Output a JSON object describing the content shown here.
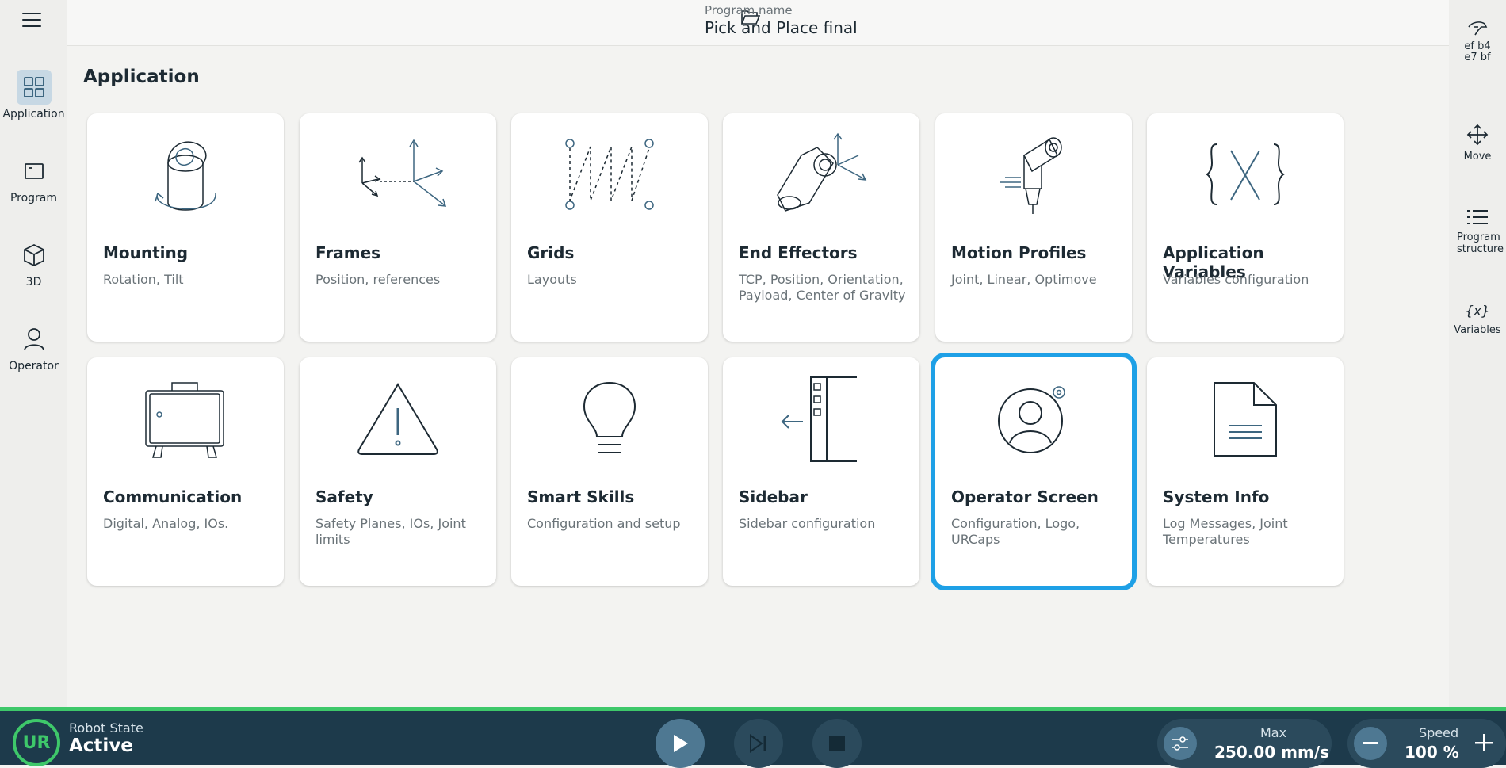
{
  "header": {
    "program_label": "Program name",
    "program_name": "Pick and Place final"
  },
  "left_nav": [
    {
      "label": "Application",
      "icon": "grid-icon",
      "active": true
    },
    {
      "label": "Program",
      "icon": "program-icon"
    },
    {
      "label": "3D",
      "icon": "cube-icon"
    },
    {
      "label": "Operator",
      "icon": "operator-icon"
    }
  ],
  "right_nav": {
    "hand_code": "ef b4\ne7 bf",
    "move": "Move",
    "program_structure": "Program structure",
    "variables": "Variables"
  },
  "main": {
    "title": "Application",
    "cards": [
      {
        "title": "Mounting",
        "subtitle": "Rotation, Tilt",
        "icon": "mounting-icon"
      },
      {
        "title": "Frames",
        "subtitle": "Position, references",
        "icon": "frames-icon"
      },
      {
        "title": "Grids",
        "subtitle": "Layouts",
        "icon": "grids-icon"
      },
      {
        "title": "End Effectors",
        "subtitle": "TCP, Position, Orientation, Payload, Center of Gravity",
        "icon": "end-effector-icon"
      },
      {
        "title": "Motion Profiles",
        "subtitle": "Joint, Linear, Optimove",
        "icon": "motion-profile-icon"
      },
      {
        "title": "Application Variables",
        "subtitle": "Variables configuration",
        "icon": "variables-icon"
      },
      {
        "title": "Communication",
        "subtitle": "Digital, Analog, IOs.",
        "icon": "communication-icon"
      },
      {
        "title": "Safety",
        "subtitle": "Safety Planes, IOs, Joint limits",
        "icon": "safety-icon"
      },
      {
        "title": "Smart Skills",
        "subtitle": "Configuration and setup",
        "icon": "lightbulb-icon"
      },
      {
        "title": "Sidebar",
        "subtitle": "Sidebar configuration",
        "icon": "sidebar-icon"
      },
      {
        "title": "Operator Screen",
        "subtitle": "Configuration, Logo, URCaps",
        "icon": "operator-screen-icon",
        "selected": true
      },
      {
        "title": "System Info",
        "subtitle": "Log Messages, Joint Temperatures",
        "icon": "document-icon"
      }
    ]
  },
  "footer": {
    "robot_state_label": "Robot State",
    "robot_state_value": "Active",
    "max_label": "Max",
    "max_value": "250.00 mm/s",
    "speed_label": "Speed",
    "speed_value": "100 %",
    "logo_text": "UR"
  },
  "colors": {
    "accent": "#1ea0e6",
    "footer_bg": "#1d3a4b",
    "status_green": "#3ec86a",
    "icon_stroke": "#3d6680"
  }
}
